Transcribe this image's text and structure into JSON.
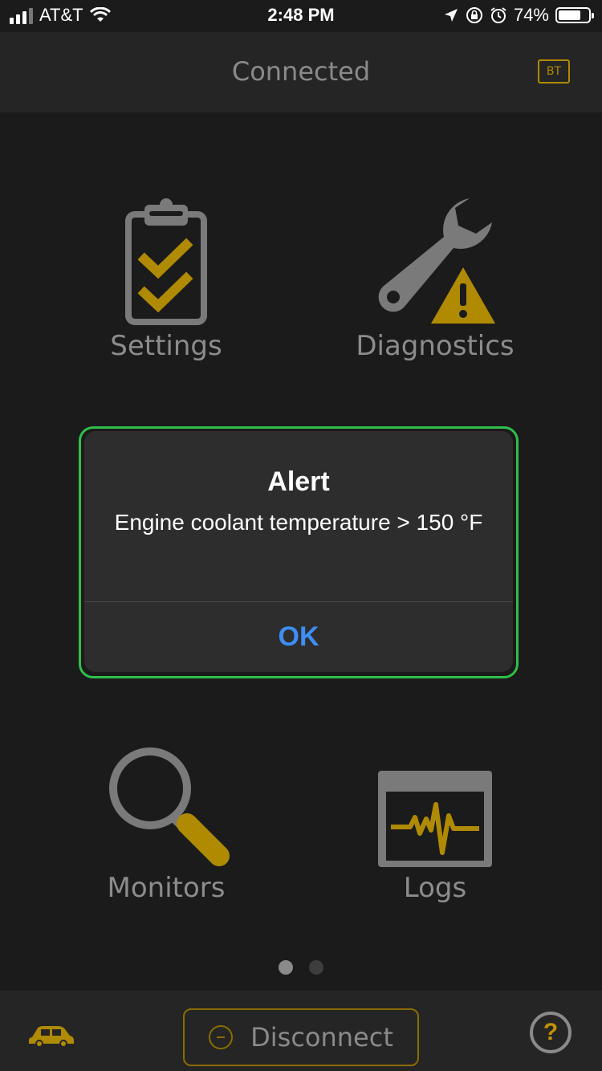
{
  "status_bar": {
    "carrier": "AT&T",
    "time": "2:48 PM",
    "battery_percent": "74%",
    "battery_level": 0.74,
    "icons": [
      "signal-icon",
      "wifi-icon",
      "location-icon",
      "rotation-lock-icon",
      "alarm-icon",
      "battery-icon"
    ]
  },
  "header": {
    "title": "Connected",
    "bt_badge": "BT"
  },
  "menu": {
    "settings": {
      "label": "Settings",
      "icon": "clipboard-check-icon"
    },
    "diagnostics": {
      "label": "Diagnostics",
      "icon": "wrench-warning-icon"
    },
    "monitors": {
      "label": "Monitors",
      "icon": "magnifier-icon"
    },
    "logs": {
      "label": "Logs",
      "icon": "waveform-monitor-icon"
    }
  },
  "alert": {
    "title": "Alert",
    "message": "Engine coolant temperature > 150 °F",
    "ok_label": "OK"
  },
  "pager": {
    "page_count": 2,
    "current_page": 1
  },
  "bottom_bar": {
    "disconnect_label": "Disconnect",
    "help_symbol": "?",
    "car_icon": "car-icon"
  },
  "colors": {
    "accent_gold": "#b08a00",
    "alert_highlight": "#2ec04a",
    "ok_blue": "#3d8ef7",
    "icon_gray": "#7a7a7a"
  }
}
